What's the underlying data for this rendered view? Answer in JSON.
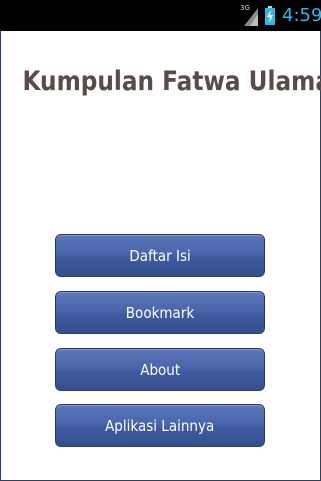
{
  "status_bar": {
    "network_label": "3G",
    "time": "4:59",
    "icons": [
      "signal-icon",
      "battery-charging-icon"
    ],
    "time_color": "#33b5e5"
  },
  "app": {
    "title": "Kumpulan Fatwa Ulama",
    "title_color": "#5a4a48"
  },
  "menu": {
    "buttons": [
      {
        "label": "Daftar Isi"
      },
      {
        "label": "Bookmark"
      },
      {
        "label": "About"
      },
      {
        "label": "Aplikasi Lainnya"
      }
    ],
    "button_color": "#4a65ab"
  }
}
